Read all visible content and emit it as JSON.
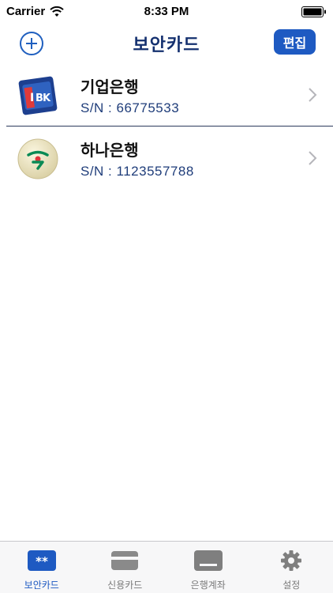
{
  "status_bar": {
    "carrier": "Carrier",
    "time": "8:33 PM"
  },
  "nav": {
    "title": "보안카드",
    "edit_label": "편집"
  },
  "cards": [
    {
      "bank": "기업은행",
      "serial": "S/N : 66775533",
      "logo_icon": "ibk-logo-icon"
    },
    {
      "bank": "하나은행",
      "serial": "S/N : 1123557788",
      "logo_icon": "hana-logo-icon"
    }
  ],
  "tabs": [
    {
      "label": "보안카드",
      "icon": "security-card-icon",
      "active": true
    },
    {
      "label": "신용카드",
      "icon": "credit-card-icon",
      "active": false
    },
    {
      "label": "은행계좌",
      "icon": "bank-account-icon",
      "active": false
    },
    {
      "label": "설정",
      "icon": "gear-icon",
      "active": false
    }
  ],
  "colors": {
    "accent": "#1e5ac2",
    "title": "#14306f",
    "serial": "#1f3d7a"
  }
}
